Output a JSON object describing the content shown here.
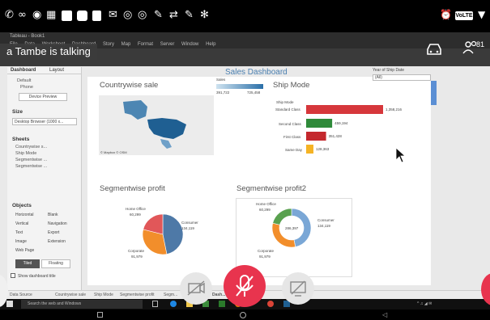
{
  "phone_status": {
    "volte": "VoLTE"
  },
  "call": {
    "speaker_banner": "a Tambe is talking",
    "participants_count": "81"
  },
  "tableau": {
    "window_title": "Tableau - Book1",
    "menu": [
      "File",
      "Data",
      "Worksheet",
      "Dashboard",
      "Story",
      "Map",
      "Format",
      "Server",
      "Window",
      "Help"
    ],
    "left_panel": {
      "tabs": [
        "Dashboard",
        "Layout"
      ],
      "device_options": [
        "Default",
        "Phone"
      ],
      "device_preview_btn": "Device Preview",
      "size_label": "Size",
      "size_value": "Desktop Browser (1000 x...",
      "sheets_label": "Sheets",
      "sheets": [
        "Countrywise s...",
        "Ship Mode",
        "Segmentwise ...",
        "Segmentwise ..."
      ],
      "objects_label": "Objects",
      "objects": [
        "Horizontal",
        "Blank",
        "Vertical",
        "Navigation",
        "Text",
        "Export",
        "Image",
        "Extension",
        "Web Page"
      ],
      "tiled_btn": "Tiled",
      "floating_btn": "Floating",
      "show_title_label": "Show dashboard title"
    },
    "dashboard": {
      "title": "Sales Dashboard",
      "year_filter_label": "Year of Ship Date",
      "year_filter_value": "(All)",
      "countrywise": {
        "title": "Countrywise sale",
        "map_credit": "© Mapbox © OSM",
        "legend_label": "Sales",
        "legend_min": "391,722",
        "legend_max": "725,458"
      },
      "shipmode": {
        "title": "Ship Mode",
        "field_label": "Ship Mode",
        "categories": [
          "Standard Class",
          "Second Class",
          "First Class",
          "Same Day"
        ],
        "labels": [
          "1,358,216",
          "459,194",
          "351,428",
          "128,363"
        ],
        "colors": [
          "#d6373b",
          "#2f8a3a",
          "#c4282d",
          "#f5b324"
        ]
      },
      "segprofit": {
        "title": "Segmentwise profit",
        "home_office_label": "Home Office",
        "home_office_value": "60,299",
        "consumer_label": "Consumer",
        "consumer_value": "134,119",
        "corporate_label": "Corporate",
        "corporate_value": "91,979"
      },
      "segprofit2": {
        "title": "Segmentwise profit2",
        "home_office_label": "Home Office",
        "home_office_value": "60,299",
        "consumer_label": "Consumer",
        "consumer_value": "134,119",
        "corporate_label": "Corporate",
        "corporate_value": "91,979",
        "center_label": "286,397"
      }
    },
    "sheet_tabs": [
      "Data Source",
      "Countrywise sale",
      "Ship Mode",
      "Segmentwise profit",
      "Segm...",
      "Dash..."
    ]
  },
  "chart_data": [
    {
      "type": "bar",
      "title": "Ship Mode",
      "categories": [
        "Standard Class",
        "Second Class",
        "First Class",
        "Same Day"
      ],
      "values": [
        1358216,
        459194,
        351428,
        128363
      ],
      "xlabel": "",
      "ylabel": "Ship Mode"
    },
    {
      "type": "pie",
      "title": "Segmentwise profit",
      "categories": [
        "Consumer",
        "Corporate",
        "Home Office"
      ],
      "values": [
        134119,
        91979,
        60299
      ]
    },
    {
      "type": "pie",
      "title": "Segmentwise profit2",
      "categories": [
        "Consumer",
        "Corporate",
        "Home Office"
      ],
      "values": [
        134119,
        91979,
        60299
      ]
    }
  ],
  "taskbar": {
    "search_placeholder": "Search the web and Windows"
  },
  "colors": {
    "mute_button": "#e8344e",
    "tableau_blue": "#4a7fb0",
    "consumer": "#4e79a7",
    "corporate": "#f28e2b",
    "home_office": "#e15759",
    "home_office_donut": "#59a14f"
  }
}
